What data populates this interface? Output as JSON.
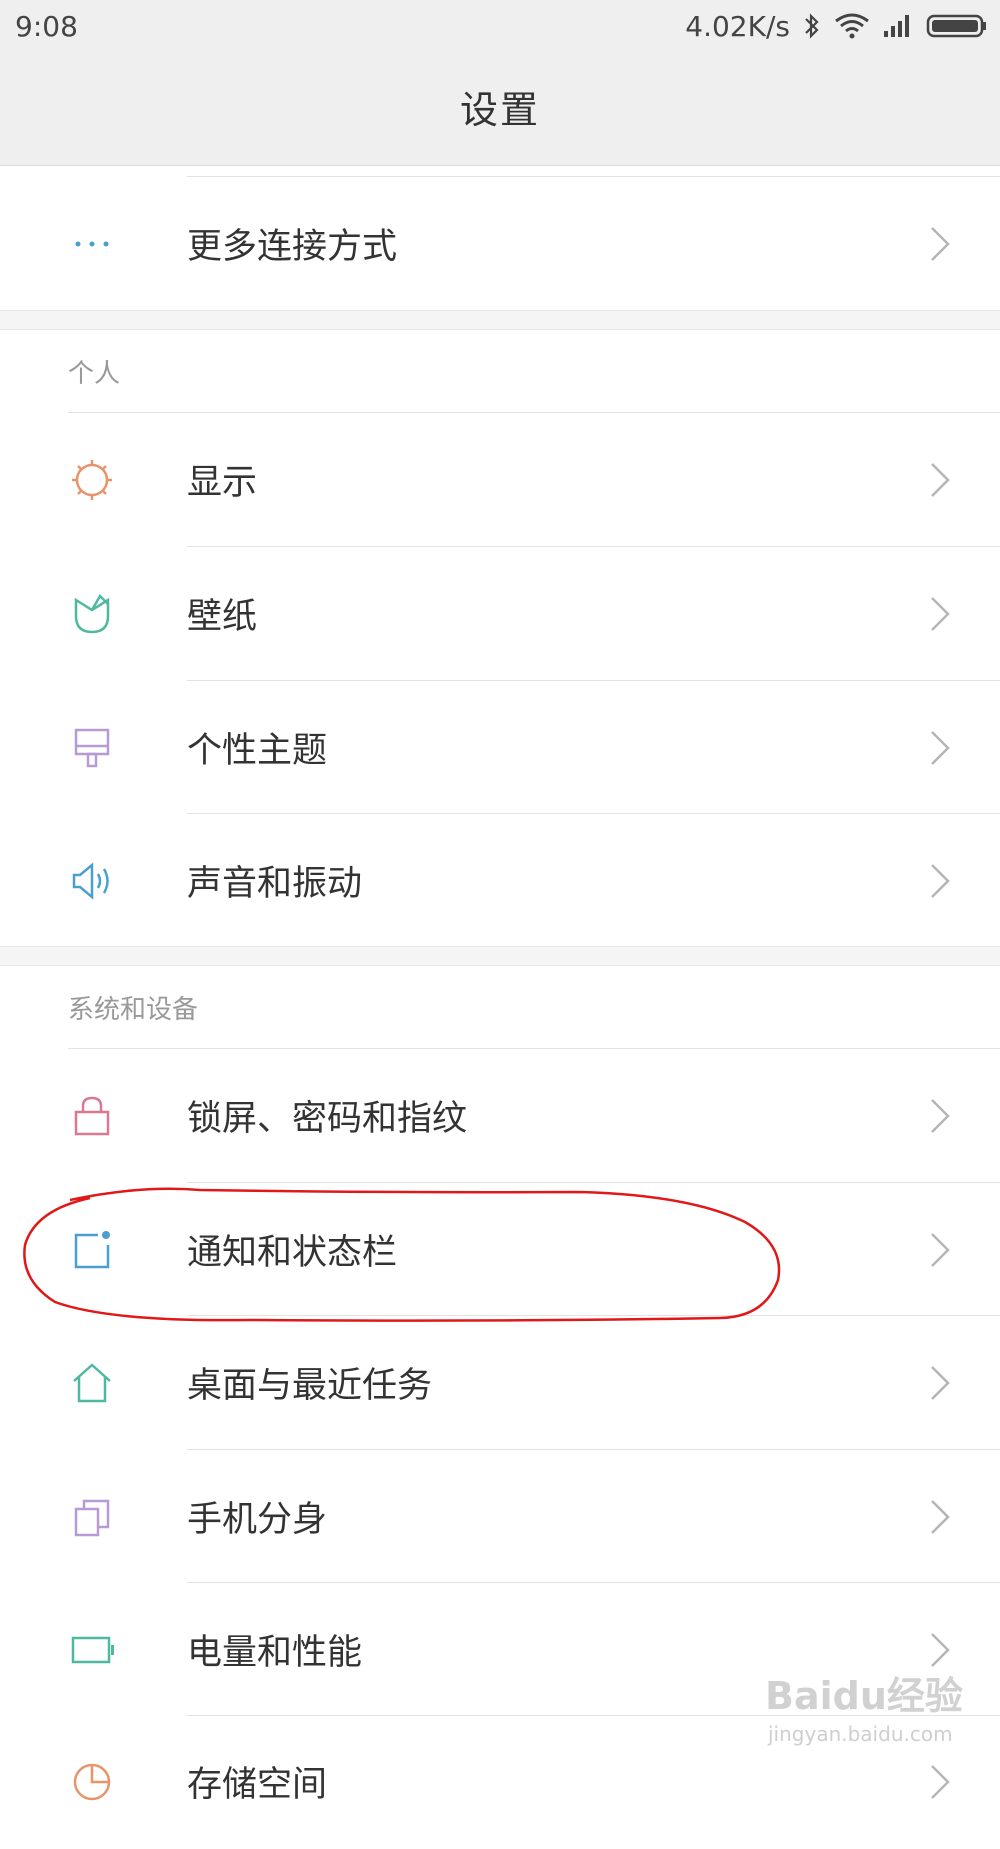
{
  "status_bar": {
    "time": "9:08",
    "net_speed": "4.02K/s"
  },
  "header": {
    "title": "设置"
  },
  "items": {
    "more_connections": "更多连接方式",
    "display": "显示",
    "wallpaper": "壁纸",
    "themes": "个性主题",
    "sound": "声音和振动",
    "lockscreen": "锁屏、密码和指纹",
    "notifications": "通知和状态栏",
    "home": "桌面与最近任务",
    "second_space": "手机分身",
    "battery": "电量和性能",
    "storage": "存储空间"
  },
  "sections": {
    "personal": "个人",
    "system": "系统和设备"
  },
  "watermark": {
    "brand": "Baidu经验",
    "url": "jingyan.baidu.com"
  },
  "colors": {
    "display": "#e8946a",
    "wallpaper": "#4fb8a0",
    "themes": "#b79ad6",
    "sound": "#4a9fd0",
    "lockscreen": "#d97890",
    "notifications": "#4a9fd0",
    "home": "#4fb8a0",
    "second_space": "#b79ad6",
    "battery": "#4fb8a0",
    "storage": "#e8946a",
    "annotation": "#e01818"
  }
}
